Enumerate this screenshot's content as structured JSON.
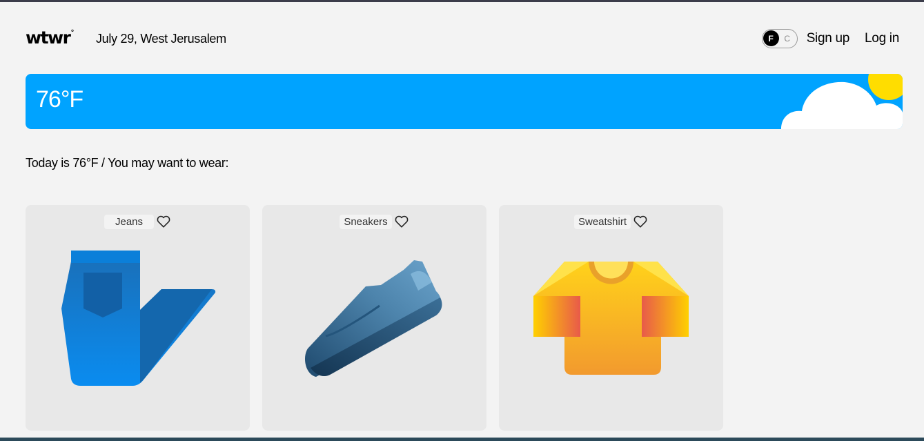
{
  "header": {
    "logo": "wtwr",
    "logo_mark": "°",
    "date_location": "July 29, West Jerusalem",
    "toggle": {
      "on": "F",
      "off": "C",
      "selected": "F"
    },
    "signup_label": "Sign up",
    "login_label": "Log in"
  },
  "weather": {
    "temperature": "76°F",
    "condition": "sunny with clouds",
    "bg_color": "#00a3ff"
  },
  "recommendation_text": "Today is 76°F / You may want to wear:",
  "items": [
    {
      "name": "Jeans",
      "icon": "jeans-icon",
      "liked": false
    },
    {
      "name": "Sneakers",
      "icon": "sneaker-icon",
      "liked": false
    },
    {
      "name": "Sweatshirt",
      "icon": "sweatshirt-icon",
      "liked": false
    }
  ]
}
